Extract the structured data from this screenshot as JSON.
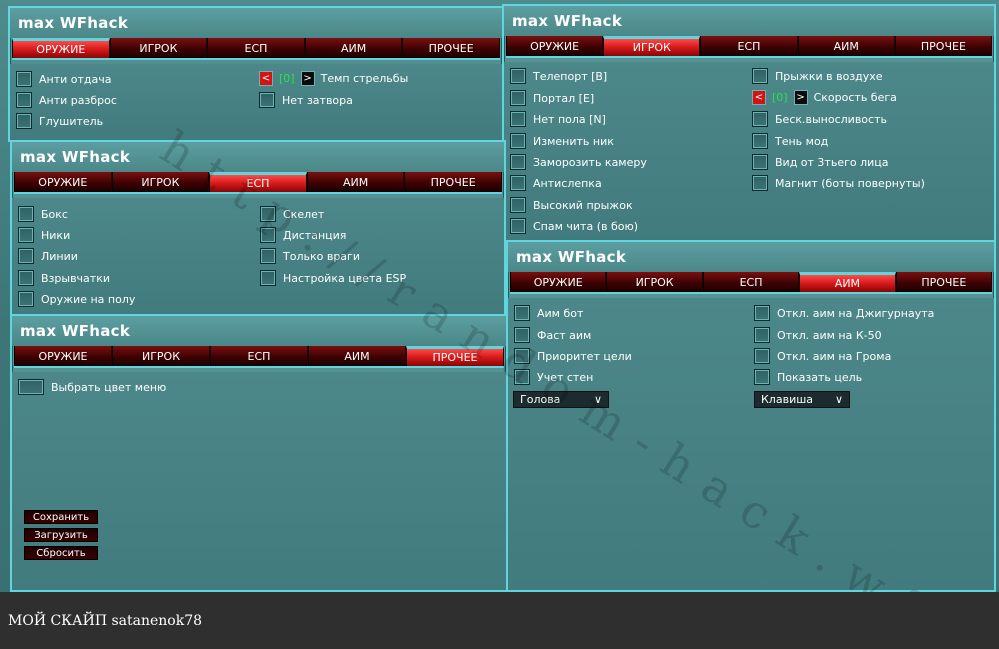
{
  "caption": "МОЙ СКАЙП satanenok78",
  "watermark": "http://random-hack.wf/",
  "panel_title": "max WFhack",
  "tabs": [
    "ОРУЖИЕ",
    "ИГРОК",
    "ЕСП",
    "АИМ",
    "ПРОЧЕЕ"
  ],
  "weapon": {
    "left": [
      "Анти отдача",
      "Анти разброс",
      "Глушитель"
    ],
    "fire_rate_value": "[0]",
    "fire_rate_label": "Темп стрельбы",
    "no_bolt": "Нет затвора"
  },
  "player": {
    "left": [
      "Телепорт [B]",
      "Портал [E]",
      "Нет пола [N]",
      "Изменить ник",
      "Заморозить камеру",
      "Антислепка",
      "Высокий прыжок",
      "Спам чита (в бою)"
    ],
    "air_jumps": "Прыжки в воздухе",
    "speed_value": "[0]",
    "speed_label": "Скорость бега",
    "right": [
      "Беск.выносливость",
      "Тень мод",
      "Вид от 3тьего лица",
      "Магнит (боты повернуты)"
    ]
  },
  "esp": {
    "left": [
      "Бокс",
      "Ники",
      "Линии",
      "Взрывчатки",
      "Оружие на полу"
    ],
    "right": [
      "Скелет",
      "Дистанция",
      "Только враги",
      "Настройка цвета ESP"
    ]
  },
  "aim": {
    "left": [
      "Аим бот",
      "Фаст аим",
      "Приоритет цели",
      "Учет стен"
    ],
    "right": [
      "Откл. аим на Джигурнаута",
      "Откл. аим на К-50",
      "Откл. аим на Грома",
      "Показать цель"
    ],
    "target_dropdown": "Голова",
    "key_dropdown": "Клавиша",
    "dropdown_arrow": "∨"
  },
  "misc": {
    "menu_color": "Выбрать цвет меню",
    "save": "Сохранить",
    "load": "Загрузить",
    "reset": "Сбросить"
  },
  "colors": {
    "accent": "#5fd6dd",
    "tab_active": "#d41a1a",
    "tab_inactive": "#3e0202",
    "value_green": "#22e64a"
  }
}
